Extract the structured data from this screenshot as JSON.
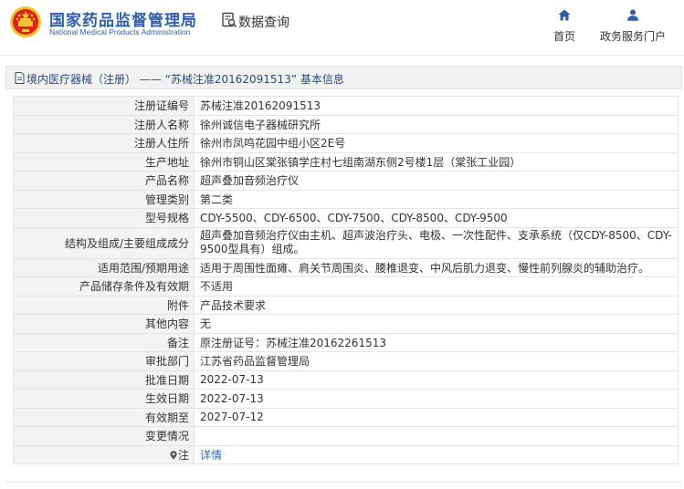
{
  "header": {
    "site_name_cn": "国家药品监督管理局",
    "site_name_en": "National Medical Products Administration",
    "db_query_label": "数据查询",
    "nav": [
      {
        "label": "首页",
        "icon": "home-icon"
      },
      {
        "label": "政务服务门户",
        "icon": "user-icon"
      }
    ]
  },
  "title": "境内医疗器械（注册） —— “苏械注准20162091513” 基本信息",
  "rows": [
    {
      "label": "注册证编号",
      "value": "苏械注准20162091513"
    },
    {
      "label": "注册人名称",
      "value": "徐州诚信电子器械研究所"
    },
    {
      "label": "注册人住所",
      "value": "徐州市凤鸣花园中组小区2E号"
    },
    {
      "label": "生产地址",
      "value": "徐州市铜山区棠张镇学庄村七组南湖东侧2号楼1层（棠张工业园）"
    },
    {
      "label": "产品名称",
      "value": "超声叠加音频治疗仪"
    },
    {
      "label": "管理类别",
      "value": "第二类"
    },
    {
      "label": "型号规格",
      "value": "CDY-5500、CDY-6500、CDY-7500、CDY-8500、CDY-9500"
    },
    {
      "label": "结构及组成/主要组成成分",
      "value": "超声叠加音频治疗仪由主机、超声波治疗头、电极、一次性配件、支承系统（仅CDY-8500、CDY-9500型具有）组成。"
    },
    {
      "label": "适用范围/预期用途",
      "value": "适用于周围性面瘫、肩关节周围炎、腰椎退变、中风后肌力退变、慢性前列腺炎的辅助治疗。"
    },
    {
      "label": "产品储存条件及有效期",
      "value": "不适用"
    },
    {
      "label": "附件",
      "value": "产品技术要求"
    },
    {
      "label": "其他内容",
      "value": "无"
    },
    {
      "label": "备注",
      "value": "原注册证号：苏械注准20162261513"
    },
    {
      "label": "审批部门",
      "value": "江苏省药品监督管理局"
    },
    {
      "label": "批准日期",
      "value": "2022-07-13"
    },
    {
      "label": "生效日期",
      "value": "2022-07-13"
    },
    {
      "label": "有效期至",
      "value": "2027-07-12"
    },
    {
      "label": "变更情况",
      "value": ""
    },
    {
      "label": "注",
      "value": "详情"
    }
  ],
  "colors": {
    "brand_blue": "#2f5fa7",
    "link_blue": "#2a6bb8",
    "emblem_red": "#d9231d",
    "emblem_gold": "#f2c230"
  }
}
